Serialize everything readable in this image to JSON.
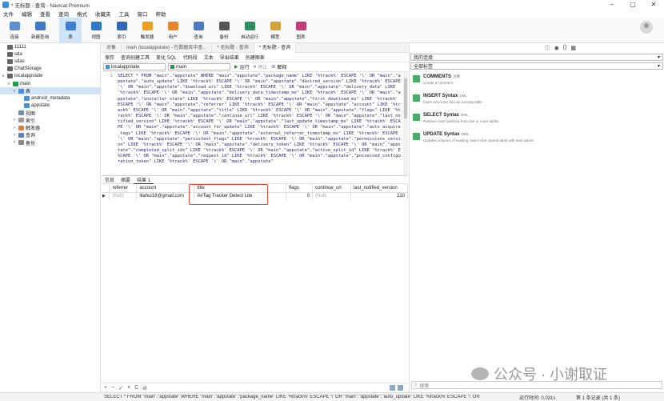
{
  "window": {
    "title": "* 无标题 - 查询 - Navicat Premium"
  },
  "menu": [
    "文件",
    "编辑",
    "查看",
    "收藏夹",
    "工具",
    "窗口",
    "帮助"
  ],
  "menu_fmt_label": "查询",
  "menu_fmt2_label": "格式",
  "toolbar": [
    {
      "label": "连接",
      "icon": "connect-icon",
      "color": "#5b8fd0"
    },
    {
      "label": "新建查询",
      "icon": "new-query-icon",
      "color": "#3e7bc4"
    },
    {
      "label": "表",
      "icon": "table-icon",
      "color": "#3d7fd0",
      "active": true
    },
    {
      "label": "视图",
      "icon": "view-icon",
      "color": "#2f79c9"
    },
    {
      "label": "索引",
      "icon": "index-icon",
      "color": "#3167b8"
    },
    {
      "label": "触发器",
      "icon": "trigger-icon",
      "color": "#f0a020"
    },
    {
      "label": "用户",
      "icon": "user-icon",
      "color": "#e8852b"
    },
    {
      "label": "查询",
      "icon": "query-icon",
      "color": "#4c7ac0"
    },
    {
      "label": "备份",
      "icon": "backup-icon",
      "color": "#555555"
    },
    {
      "label": "自动运行",
      "icon": "automation-icon",
      "color": "#2f8f5a"
    },
    {
      "label": "模型",
      "icon": "model-icon",
      "color": "#d2a13a"
    },
    {
      "label": "图表",
      "icon": "chart-icon",
      "color": "#c43b7a"
    }
  ],
  "sidebar": {
    "items": [
      {
        "label": "11111",
        "icon": "conn",
        "indent": 0,
        "expander": ""
      },
      {
        "label": "sda",
        "icon": "conn",
        "indent": 0,
        "expander": ""
      },
      {
        "label": "sdas",
        "icon": "conn",
        "indent": 0,
        "expander": ""
      },
      {
        "label": "ChatStorage",
        "icon": "conn",
        "indent": 0,
        "expander": ""
      },
      {
        "label": "localappstate",
        "icon": "conn",
        "indent": 0,
        "expander": "∨"
      },
      {
        "label": "main",
        "icon": "db",
        "indent": 1,
        "expander": "∨"
      },
      {
        "label": "表",
        "icon": "tbl",
        "indent": 2,
        "expander": "∨",
        "selected": true
      },
      {
        "label": "android_metadata",
        "icon": "tbl",
        "indent": 3,
        "expander": ""
      },
      {
        "label": "appstate",
        "icon": "tbl",
        "indent": 3,
        "expander": ""
      },
      {
        "label": "视图",
        "icon": "view",
        "indent": 2,
        "expander": ""
      },
      {
        "label": "索引",
        "icon": "fn",
        "indent": 2,
        "expander": ">"
      },
      {
        "label": "触发器",
        "icon": "trig",
        "indent": 2,
        "expander": ">"
      },
      {
        "label": "查询",
        "icon": "query",
        "indent": 2,
        "expander": ">"
      },
      {
        "label": "备份",
        "icon": "backup",
        "indent": 2,
        "expander": ">"
      }
    ]
  },
  "tabs": [
    {
      "label": "对象"
    },
    {
      "label": "main (localappstate) - 在数据库中查..."
    },
    {
      "label": "* 无标题 - 查询"
    },
    {
      "label": "* 无标题 - 查询",
      "active": true
    }
  ],
  "query_toolbar": [
    "保存",
    "查询创建工具",
    "美化 SQL",
    "代码段",
    "文本",
    "导出结果",
    "创建图表"
  ],
  "selectors": {
    "connection": "localappstate",
    "database": "main",
    "run": "运行",
    "stop": "停止",
    "explain": "解释"
  },
  "editor": {
    "line_number": "1",
    "sql": "SELECT * FROM \"main\".\"appstate\" WHERE \"main\".\"appstate\".\"package_name\" LIKE '%track%' ESCAPE '\\' OR \"main\".\"appstate\".\"auto_update\" LIKE '%track%' ESCAPE '\\' OR \"main\".\"appstate\".\"desired_version\" LIKE '%track%' ESCAPE '\\' OR \"main\".\"appstate\".\"download_uri\" LIKE '%track%' ESCAPE '\\' OR \"main\".\"appstate\".\"delivery_data\" LIKE '%track%' ESCAPE '\\' OR \"main\".\"appstate\".\"delivery_data_timestamp_ms\" LIKE '%track%' ESCAPE '\\' OR \"main\".\"appstate\".\"installer_state\" LIKE '%track%' ESCAPE '\\' OR \"main\".\"appstate\".\"first_download_ms\" LIKE '%track%' ESCAPE '\\' OR \"main\".\"appstate\".\"referrer\" LIKE '%track%' ESCAPE '\\' OR \"main\".\"appstate\".\"account\" LIKE '%track%' ESCAPE '\\' OR \"main\".\"appstate\".\"title\" LIKE '%track%' ESCAPE '\\' OR \"main\".\"appstate\".\"flags\" LIKE '%track%' ESCAPE '\\' OR \"main\".\"appstate\".\"continue_url\" LIKE '%track%' ESCAPE '\\' OR \"main\".\"appstate\".\"last_notified_version\" LIKE '%track%' ESCAPE '\\' OR \"main\".\"appstate\".\"last_update_timestamp_ms\" LIKE '%track%' ESCAPE '\\' OR \"main\".\"appstate\".\"account_for_update\" LIKE '%track%' ESCAPE '\\' OR \"main\".\"appstate\".\"auto_acquire_tags\" LIKE '%track%' ESCAPE '\\' OR \"main\".\"appstate\".\"external_referrer_timestamp_ms\" LIKE '%track%' ESCAPE '\\' OR \"main\".\"appstate\".\"persistent_flags\" LIKE '%track%' ESCAPE '\\' OR \"main\".\"appstate\".\"permissions_version\" LIKE '%track%' ESCAPE '\\' OR \"main\".\"appstate\".\"delivery_token\" LIKE '%track%' ESCAPE '\\' OR \"main\".\"appstate\".\"completed_split_ids\" LIKE '%track%' ESCAPE '\\' OR \"main\".\"appstate\".\"active_split_id\" LIKE '%track%' ESCAPE '\\' OR \"main\".\"appstate\".\"request_id\" LIKE '%track%' ESCAPE '\\' OR \"main\".\"appstate\".\"possessed_configuration_token\" LIKE '%track%' ESCAPE '\\' OR \"main\".\"appstate\""
  },
  "result_tabs": [
    "信息",
    "摘要",
    "结果 1"
  ],
  "grid": {
    "columns": [
      "referrer",
      "account",
      "title",
      "flags",
      "continue_url",
      "last_notified_version"
    ],
    "rows": [
      {
        "referrer": "(Null)",
        "account": "lilahui18@gmail.com",
        "title": "AirTag Tracker Detect Lite",
        "flags": "0",
        "continue_url": "(Null)",
        "last_notified_version": "210"
      }
    ],
    "highlight_color": "#e24a3b"
  },
  "grid_footer": [
    "+",
    "−",
    "✓",
    "×",
    "C",
    "⊘"
  ],
  "right_panel": {
    "connection_select": "我的连接",
    "label_select": "全部标签",
    "snippets": [
      {
        "name": "COMMENTS",
        "tag": "注释",
        "desc": "Create a comment"
      },
      {
        "name": "INSERT Syntax",
        "tag": "DML",
        "desc": "Insert new rows into an existing table"
      },
      {
        "name": "SELECT Syntax",
        "tag": "DML",
        "desc": "Retrieve rows selected from one or more tables"
      },
      {
        "name": "UPDATE Syntax",
        "tag": "DML",
        "desc": "Updates columns of existing rows in the named table with new values"
      }
    ],
    "search_placeholder": "搜索"
  },
  "watermark": "公众号 · 小谢取证",
  "statusbar": {
    "sql": "SELECT * FROM \"main\".\"appstate\" WHERE \"main\".\"appstate\".\"package_name\" LIKE '%track%' ESCAPE '\\' OR \"main\".\"appstate\".\"auto_update\" LIKE '%track%' ESCAPE '\\' OR",
    "time": "运行时间: 0.031s",
    "records": "第 1 条记录 (共 1 条)"
  }
}
